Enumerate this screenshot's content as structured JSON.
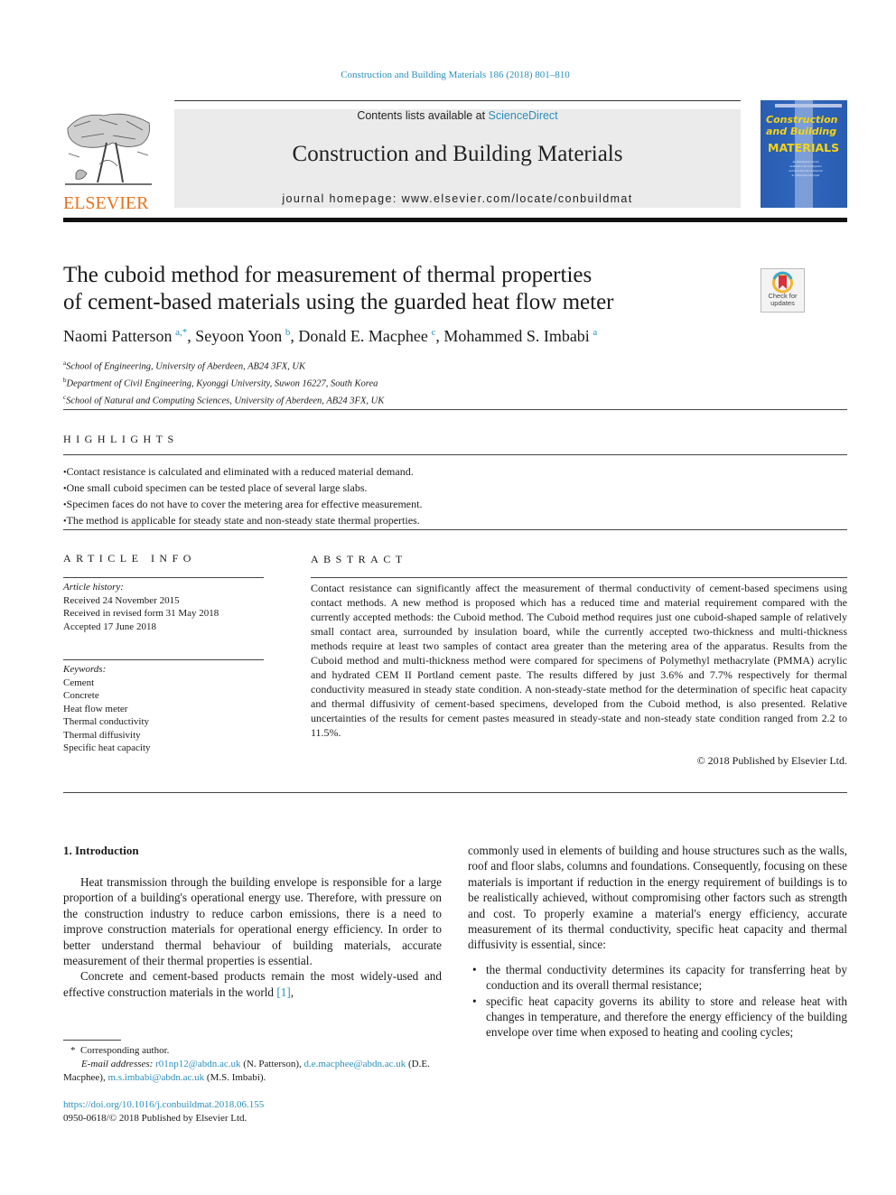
{
  "header": {
    "citation": "Construction and Building Materials 186 (2018) 801–810",
    "contents_prefix": "Contents lists available at ",
    "contents_link": "ScienceDirect",
    "journal_title": "Construction and Building Materials",
    "homepage": "journal homepage: www.elsevier.com/locate/conbuildmat",
    "publisher_logo": "ELSEVIER",
    "cover": {
      "line1": "Construction",
      "line2": "and Building",
      "line3": "MATERIALS",
      "fine_print": "An International Journal dedicated to the investigation and innovative use of materials in construction and repair"
    },
    "colors": {
      "link": "#2a8fbd",
      "elsevier_orange": "#e8731c",
      "cover_blue": "#2f66bf",
      "cover_yellow": "#f4d31a"
    }
  },
  "article": {
    "title_line1": "The cuboid method for measurement of thermal properties",
    "title_line2": "of cement-based materials using the guarded heat flow meter",
    "check_updates": {
      "line1": "Check for",
      "line2": "updates"
    },
    "authors": [
      {
        "name": "Naomi Patterson",
        "sup": "a,*"
      },
      {
        "name": "Seyoon Yoon",
        "sup": "b"
      },
      {
        "name": "Donald E. Macphee",
        "sup": "c"
      },
      {
        "name": "Mohammed S. Imbabi",
        "sup": "a"
      }
    ],
    "affiliations": [
      {
        "key": "a",
        "text": "School of Engineering, University of Aberdeen, AB24 3FX, UK"
      },
      {
        "key": "b",
        "text": "Department of Civil Engineering, Kyonggi University, Suwon 16227, South Korea"
      },
      {
        "key": "c",
        "text": "School of Natural and Computing Sciences, University of Aberdeen, AB24 3FX, UK"
      }
    ]
  },
  "highlights": {
    "heading": "HIGHLIGHTS",
    "items": [
      "Contact resistance is calculated and eliminated with a reduced material demand.",
      "One small cuboid specimen can be tested place of several large slabs.",
      "Specimen faces do not have to cover the metering area for effective measurement.",
      "The method is applicable for steady state and non-steady state thermal properties."
    ]
  },
  "article_info": {
    "heading": "ARTICLE INFO",
    "history_label": "Article history:",
    "history": [
      "Received 24 November 2015",
      "Received in revised form 31 May 2018",
      "Accepted 17 June 2018"
    ],
    "keywords_label": "Keywords:",
    "keywords": [
      "Cement",
      "Concrete",
      "Heat flow meter",
      "Thermal conductivity",
      "Thermal diffusivity",
      "Specific heat capacity"
    ]
  },
  "abstract": {
    "heading": "ABSTRACT",
    "text": "Contact resistance can significantly affect the measurement of thermal conductivity of cement-based specimens using contact methods. A new method is proposed which has a reduced time and material requirement compared with the currently accepted methods: the Cuboid method. The Cuboid method requires just one cuboid-shaped sample of relatively small contact area, surrounded by insulation board, while the currently accepted two-thickness and multi-thickness methods require at least two samples of contact area greater than the metering area of the apparatus. Results from the Cuboid method and multi-thickness method were compared for specimens of Polymethyl methacrylate (PMMA) acrylic and hydrated CEM II Portland cement paste. The results differed by just 3.6% and 7.7% respectively for thermal conductivity measured in steady state condition. A non-steady-state method for the determination of specific heat capacity and thermal diffusivity of cement-based specimens, developed from the Cuboid method, is also presented. Relative uncertainties of the results for cement pastes measured in steady-state and non-steady state condition ranged from 2.2 to 11.5%.",
    "copyright": "© 2018 Published by Elsevier Ltd."
  },
  "body": {
    "intro_heading": "1. Introduction",
    "left_paragraphs": [
      "Heat transmission through the building envelope is responsible for a large proportion of a building's operational energy use. Therefore, with pressure on the construction industry to reduce carbon emissions, there is a need to improve construction materials for operational energy efficiency. In order to better understand thermal behaviour of building materials, accurate measurement of their thermal properties is essential."
    ],
    "left_para2_text": "Concrete and cement-based products remain the most widely-used and effective construction materials in the world ",
    "left_para2_ref": "[1]",
    "left_para2_tail": ",",
    "right_paragraph": "commonly used in elements of building and house structures such as the walls, roof and floor slabs, columns and foundations. Consequently, focusing on these materials is important if reduction in the energy requirement of buildings is to be realistically achieved, without compromising other factors such as strength and cost. To properly examine a material's energy efficiency, accurate measurement of its thermal conductivity, specific heat capacity and thermal diffusivity is essential, since:",
    "right_bullets": [
      "the thermal conductivity determines its capacity for transferring heat by conduction and its overall thermal resistance;",
      "specific heat capacity governs its ability to store and release heat with changes in temperature, and therefore the energy efficiency of the building envelope over time when exposed to heating and cooling cycles;"
    ]
  },
  "footnotes": {
    "corresponding": "Corresponding author.",
    "emails_label": "E-mail addresses: ",
    "emails": [
      {
        "email": "r01np12@abdn.ac.uk",
        "who": " (N. Patterson), "
      },
      {
        "email": "d.e.macphee@abdn.ac.uk",
        "who": " (D.E. Macphee), "
      },
      {
        "email": "m.s.imbabi@abdn.ac.uk",
        "who": " (M.S. Imbabi)."
      }
    ],
    "doi": "https://doi.org/10.1016/j.conbuildmat.2018.06.155",
    "issn": "0950-0618/© 2018 Published by Elsevier Ltd."
  }
}
